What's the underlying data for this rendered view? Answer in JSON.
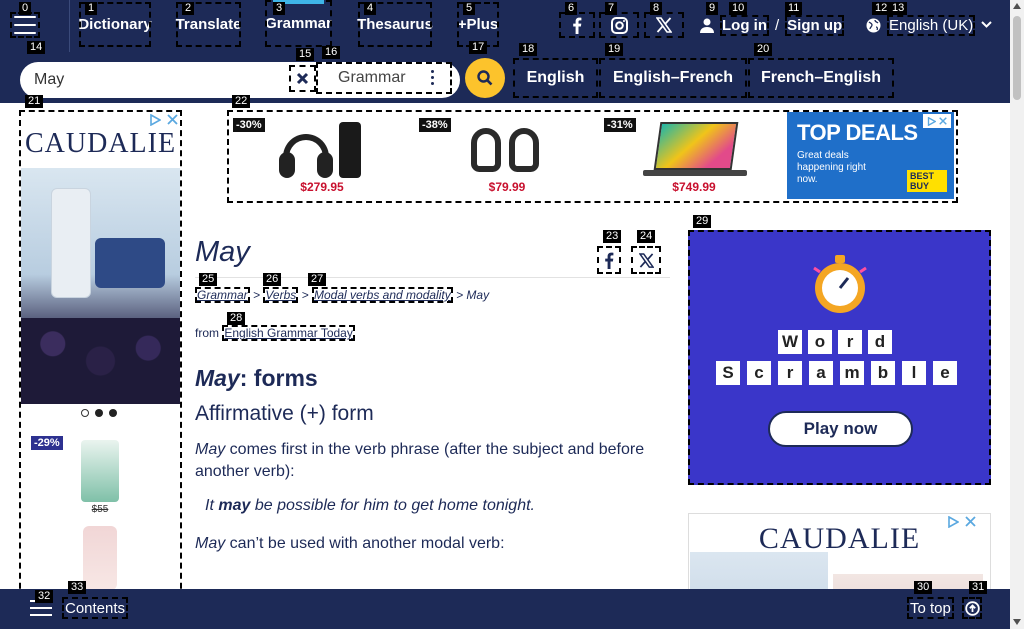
{
  "nav": {
    "items": [
      "Dictionary",
      "Translate",
      "Grammar",
      "Thesaurus",
      "+Plus"
    ],
    "login": "Log in",
    "separator": "/",
    "signup": "Sign up",
    "language": "English (UK)"
  },
  "search": {
    "value": "May",
    "dictionary": "Grammar",
    "tabs": [
      "English",
      "English–French",
      "French–English"
    ]
  },
  "ads": {
    "left": {
      "brand": "CAUDALIE",
      "discount": "-29%",
      "price": "$55"
    },
    "top": {
      "products": [
        {
          "discount": "-30%",
          "price": "$279.95"
        },
        {
          "discount": "-38%",
          "price": "$79.99"
        },
        {
          "discount": "-31%",
          "price": "$749.99"
        }
      ],
      "banner_title": "TOP DEALS",
      "banner_text": "Great deals happening right now.",
      "banner_logo": "BEST BUY"
    },
    "game": {
      "row1": [
        "W",
        "o",
        "r",
        "d"
      ],
      "row2": [
        "S",
        "c",
        "r",
        "a",
        "m",
        "b",
        "l",
        "e"
      ],
      "button": "Play now"
    },
    "right2_brand": "CAUDALIE"
  },
  "article": {
    "title": "May",
    "breadcrumb": [
      "Grammar",
      "Verbs",
      "Modal verbs and modality",
      "May"
    ],
    "sep": ">",
    "from_label": "from",
    "source": "English Grammar Today",
    "heading_word": "May",
    "heading_rest": ": forms",
    "subheading": "Affirmative (+) form",
    "p1_word": "May",
    "p1_rest": " comes first in the verb phrase (after the subject and before another verb):",
    "ex1_pre": "It ",
    "ex1_word": "may",
    "ex1_post": " be possible for him to get home tonight.",
    "p2_word": "May",
    "p2_rest": " can’t be used with another modal verb:"
  },
  "bottom": {
    "contents": "Contents",
    "to_top": "To top"
  },
  "badges": [
    "0",
    "1",
    "2",
    "3",
    "4",
    "5",
    "6",
    "7",
    "8",
    "9",
    "10",
    "11",
    "12",
    "13",
    "14",
    "15",
    "16",
    "17",
    "18",
    "19",
    "20",
    "21",
    "22",
    "23",
    "24",
    "25",
    "26",
    "27",
    "28",
    "29",
    "30",
    "31",
    "32",
    "33"
  ],
  "colors": {
    "navy": "#1d2a57",
    "accent_blue": "#3fb5e8",
    "search_yellow": "#fcc32c",
    "game_purple": "#3a36c9"
  },
  "icons": [
    "hamburger-icon",
    "facebook-icon",
    "instagram-icon",
    "x-icon",
    "user-icon",
    "globe-icon",
    "chevron-down-icon",
    "close-icon",
    "kebab-icon",
    "search-icon",
    "arrow-up-circle-icon",
    "menu-icon"
  ]
}
